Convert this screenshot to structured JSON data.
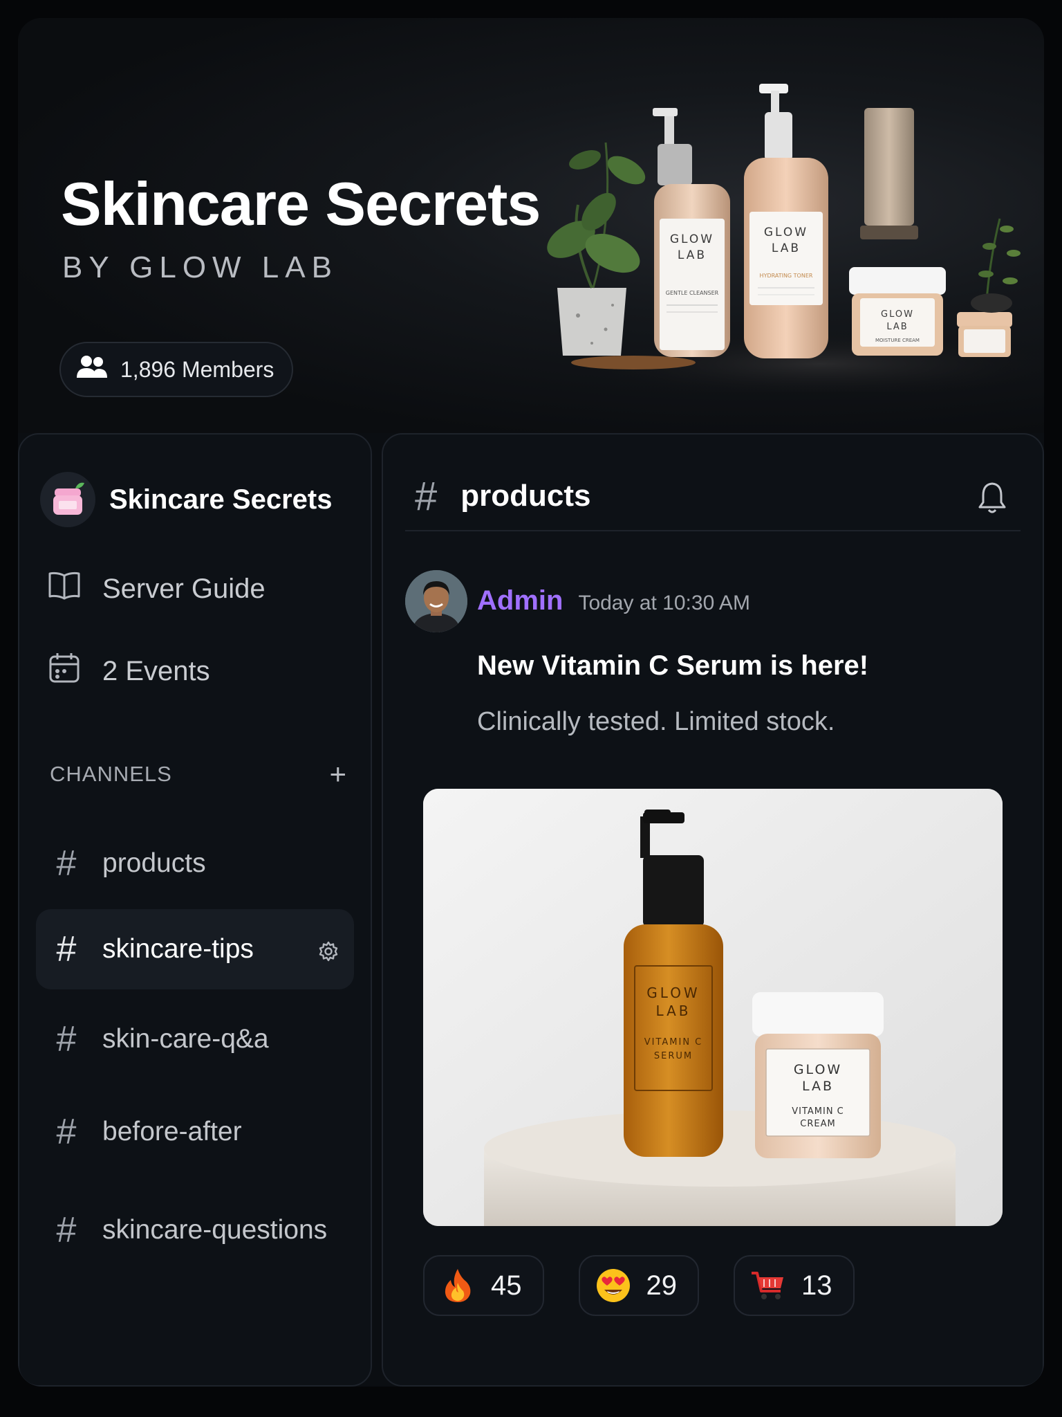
{
  "hero": {
    "title": "Skincare Secrets",
    "subtitle": "BY GLOW LAB",
    "members": "1,896 Members",
    "product_labels": {
      "brand_line1": "GLOW",
      "brand_line2": "LAB",
      "cleanser": "GENTLE CLEANSER",
      "toner": "HYDRATING TONER",
      "cream": "MOISTURE CREAM"
    }
  },
  "sidebar": {
    "server_name": "Skincare Secrets",
    "guide": "Server Guide",
    "events": "2 Events",
    "channels_header": "CHANNELS",
    "channels": [
      {
        "name": "products"
      },
      {
        "name": "skincare-tips"
      },
      {
        "name": "skin-care-q&a"
      },
      {
        "name": "before-after"
      },
      {
        "name": "skincare-questions"
      }
    ]
  },
  "main": {
    "channel_title": "products",
    "message": {
      "author": "Admin",
      "timestamp": "Today at 10:30 AM",
      "headline": "New Vitamin C Serum is here!",
      "body": "Clinically tested. Limited stock.",
      "image_labels": {
        "brand_line1": "GLOW",
        "brand_line2": "LAB",
        "serum_1": "VITAMIN C",
        "serum_2": "SERUM",
        "cream_1": "VITAMIN C",
        "cream_2": "CREAM"
      }
    },
    "reactions": [
      {
        "emoji": "fire-emoji",
        "count": "45"
      },
      {
        "emoji": "heart-eyes-emoji",
        "count": "29"
      },
      {
        "emoji": "shopping-cart-emoji",
        "count": "13"
      }
    ]
  },
  "colors": {
    "background": "#0b0e12",
    "panel": "#0d1116",
    "author_accent": "#a070ff",
    "active_channel": "#171c23"
  }
}
